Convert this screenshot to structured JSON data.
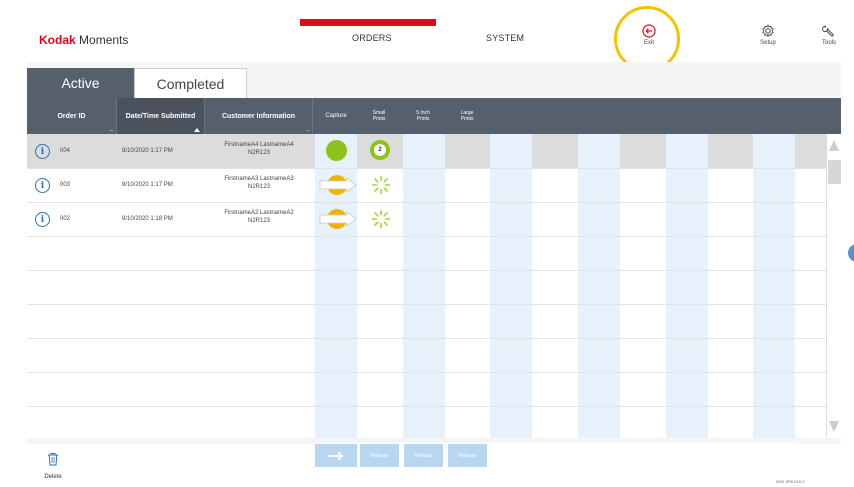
{
  "header": {
    "logo_brand": "Kodak",
    "logo_rest": " Moments",
    "nav": {
      "orders": "ORDERS",
      "system": "SYSTEM"
    },
    "buttons": {
      "exit": "Exit",
      "setup": "Setup",
      "tools": "Tools"
    },
    "colors": {
      "brand_red": "#e3001b",
      "active_bar": "#d90e1c",
      "highlight_ring": "#f2c500"
    }
  },
  "tabs": {
    "active": "Active",
    "completed": "Completed"
  },
  "table": {
    "headers": {
      "order_id": "Order ID",
      "date": "Date/Time Submitted",
      "customer": "Customer Information",
      "capture": "Capture",
      "small_prints_1": "Small",
      "small_prints_2": "Prints",
      "inch5_1": "5 Inch",
      "inch5_2": "Prints",
      "large_1": "Large",
      "large_2": "Prints"
    },
    "rows": [
      {
        "id": "004",
        "date": "8/10/2020 1:17 PM",
        "name": "FirstnameA4 LastnameA4",
        "code": "N2R123",
        "capture": "complete",
        "prints": "2",
        "prints_state": "complete",
        "selected": true
      },
      {
        "id": "003",
        "date": "8/10/2020 1:17 PM",
        "name": "FirstnameA3 LastnameA3",
        "code": "N2R123",
        "capture": "transferring",
        "prints_state": "processing",
        "selected": false
      },
      {
        "id": "002",
        "date": "8/10/2020 1:18 PM",
        "name": "FirstnameA2 LastnameA2",
        "code": "N2R123",
        "capture": "transferring",
        "prints_state": "processing",
        "selected": false
      }
    ]
  },
  "footer": {
    "release_labels": [
      "Release",
      "Release",
      "Release"
    ],
    "delete": "Delete",
    "version": "W10 SP8 V10.2"
  },
  "icons": {
    "exit": "exit-arrow-icon",
    "setup": "gear-icon",
    "tools": "wrench-icon",
    "info": "info-icon",
    "delete": "trash-icon",
    "arrow": "right-arrow-icon"
  }
}
